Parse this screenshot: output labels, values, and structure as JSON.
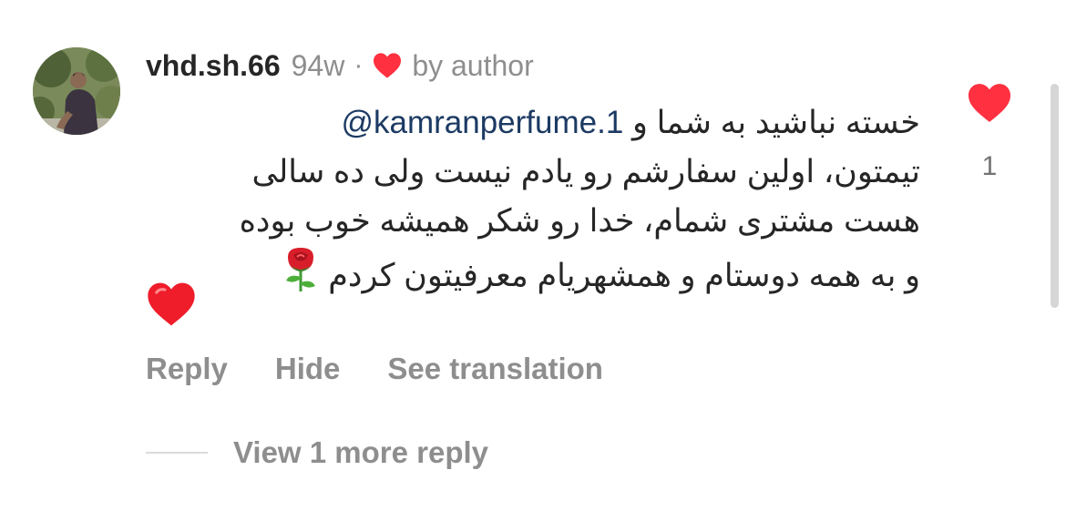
{
  "comment": {
    "username": "vhd.sh.66",
    "timestamp": "94w",
    "separator": "·",
    "author_badge": "by author",
    "mention": "@kamranperfume.1",
    "lines": [
      "خسته نباشید به شما و",
      "تیمتون، اولین سفارشم رو یادم نیست ولی ده سالی",
      "هست مشتری شمام، خدا رو شکر همیشه خوب بوده",
      "و به همه دوستام و همشهریام معرفیتون کردم"
    ],
    "icons": {
      "author_heart": "red-heart-icon",
      "rose": "rose-emoji-icon",
      "heart_emoji": "red-heart-emoji-icon",
      "like": "like-heart-icon"
    },
    "colors": {
      "heart_red": "#ff3040",
      "mention": "#1c3a63",
      "muted": "#8e8e8e"
    }
  },
  "actions": {
    "reply": "Reply",
    "hide": "Hide",
    "see_translation": "See translation"
  },
  "replies": {
    "view_more": "View 1 more reply"
  },
  "likes": {
    "count": "1"
  }
}
